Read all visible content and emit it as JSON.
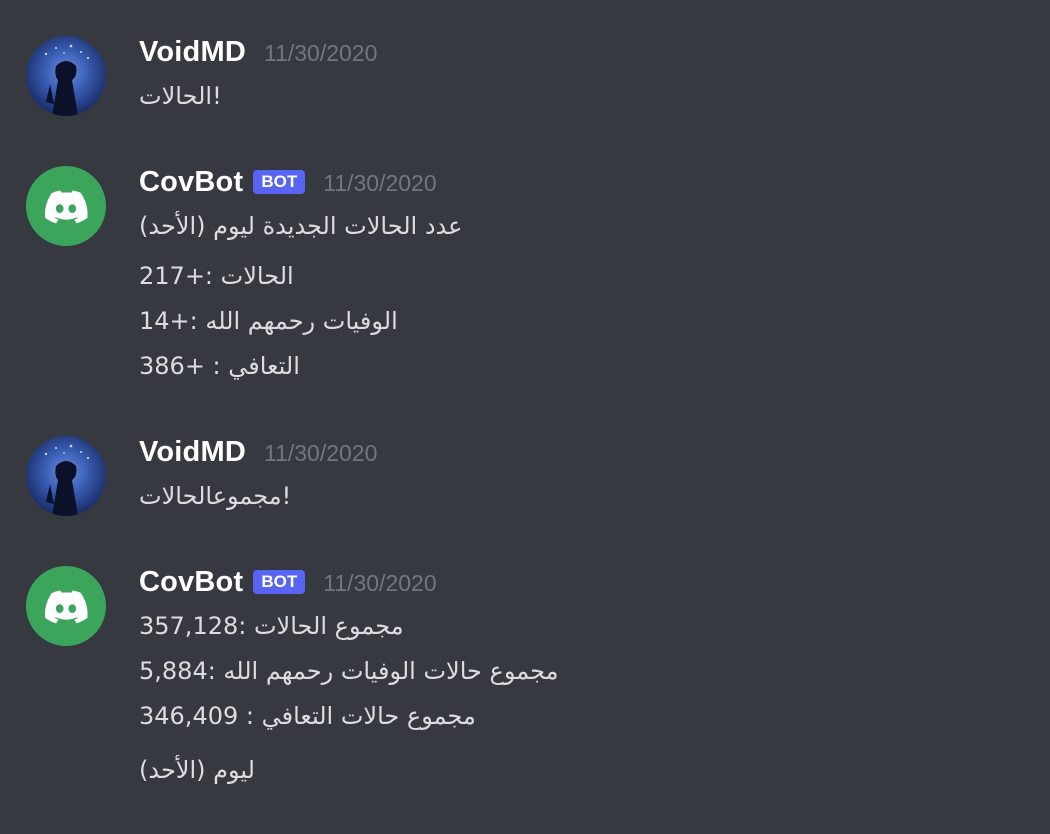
{
  "messages": [
    {
      "username": "VoidMD",
      "timestamp": "11/30/2020",
      "avatar": "user-avatar-dark-figure",
      "lines": [
        "!الحالات"
      ]
    },
    {
      "username": "CovBot",
      "tag": "BOT",
      "timestamp": "11/30/2020",
      "avatar": "discord-logo-icon",
      "lines": [
        "عدد الحالات الجديدة ليوم (الأحد)",
        "الحالات :+217",
        "الوفيات رحمهم الله :+14",
        "التعافي : +386"
      ]
    },
    {
      "username": "VoidMD",
      "timestamp": "11/30/2020",
      "avatar": "user-avatar-dark-figure",
      "lines": [
        "!مجموعالحالات"
      ]
    },
    {
      "username": "CovBot",
      "tag": "BOT",
      "timestamp": "11/30/2020",
      "avatar": "discord-logo-icon",
      "lines": [
        "مجموع الحالات :357,128",
        "مجموع حالات الوفيات رحمهم الله :5,884",
        "مجموع حالات التعافي : 346,409",
        "ليوم (الأحد)"
      ]
    }
  ],
  "colors": {
    "background": "#36393f",
    "username": "#ffffff",
    "text": "#dcddde",
    "timestamp": "#72767d",
    "bot_tag": "#5865f2",
    "bot_avatar": "#3ba55c"
  }
}
